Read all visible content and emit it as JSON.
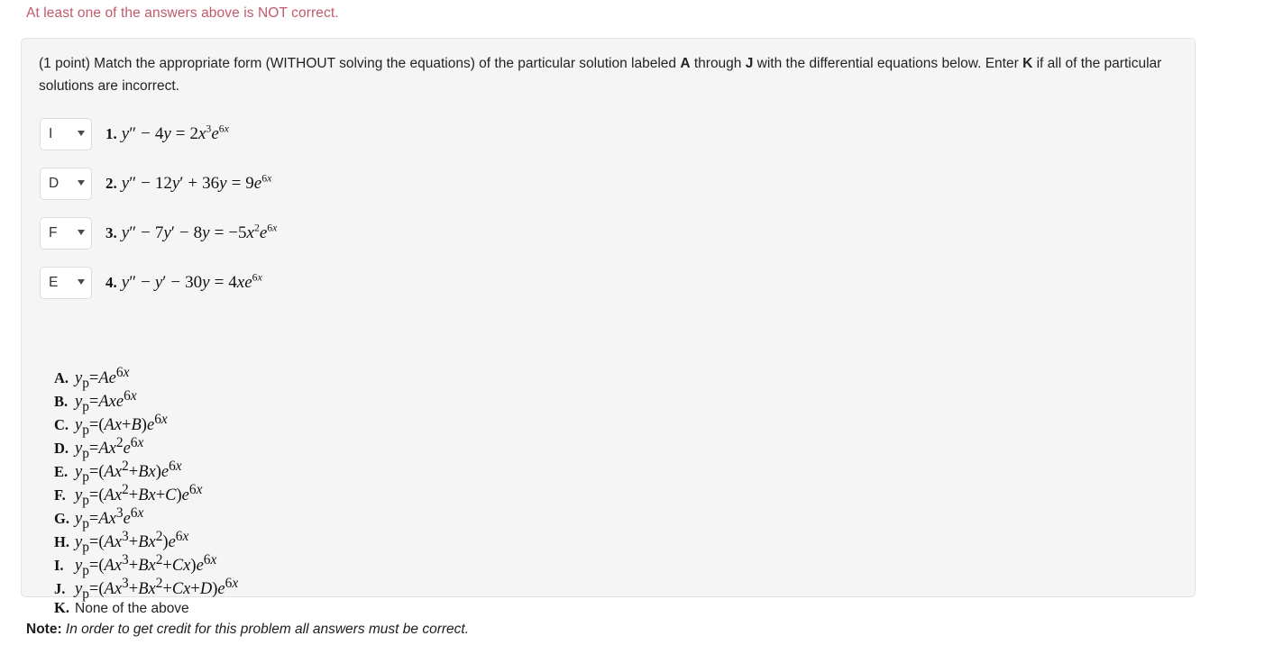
{
  "alert": {
    "text": "At least one of the answers above is NOT correct.",
    "color": "#c05a6b"
  },
  "problem": {
    "prompt_part1": "(1 point) Match the appropriate form (WITHOUT solving the equations) of the particular solution labeled ",
    "prompt_bold_a": "A",
    "prompt_part2": " through ",
    "prompt_bold_j": "J",
    "prompt_part3": " with the differential equations below. Enter ",
    "prompt_bold_k": "K",
    "prompt_part4": " if all of the particular solutions are incorrect.",
    "equations": [
      {
        "selected": "I",
        "number": "1.",
        "equation_text": "y'' − 4y = 2x³e^(6x)",
        "caret": "chevron-down-icon"
      },
      {
        "selected": "D",
        "number": "2.",
        "equation_text": "y'' − 12y' + 36y = 9e^(6x)",
        "caret": "chevron-down-icon"
      },
      {
        "selected": "F",
        "number": "3.",
        "equation_text": "y'' − 7y' − 8y = −5x²e^(6x)",
        "caret": "chevron-down-icon"
      },
      {
        "selected": "E",
        "number": "4.",
        "equation_text": "y'' − y' − 30y = 4xe^(6x)",
        "caret": "chevron-down-icon"
      }
    ],
    "options": [
      {
        "letter": "A.",
        "text": "y_p = Ae^(6x)"
      },
      {
        "letter": "B.",
        "text": "y_p = Axe^(6x)"
      },
      {
        "letter": "C.",
        "text": "y_p = (Ax + B)e^(6x)"
      },
      {
        "letter": "D.",
        "text": "y_p = Ax²e^(6x)"
      },
      {
        "letter": "E.",
        "text": "y_p = (Ax² + Bx)e^(6x)"
      },
      {
        "letter": "F.",
        "text": "y_p = (Ax² + Bx + C)e^(6x)"
      },
      {
        "letter": "G.",
        "text": "y_p = Ax³e^(6x)"
      },
      {
        "letter": "H.",
        "text": "y_p = (Ax³ + Bx²)e^(6x)"
      },
      {
        "letter": "I.",
        "text": "y_p = (Ax³ + Bx² + Cx)e^(6x)"
      },
      {
        "letter": "J.",
        "text": "y_p = (Ax³ + Bx² + Cx + D)e^(6x)"
      },
      {
        "letter": "K.",
        "text": "None of the above"
      }
    ]
  },
  "note": {
    "label": "Note:",
    "body": " In order to get credit for this problem all answers must be correct."
  }
}
